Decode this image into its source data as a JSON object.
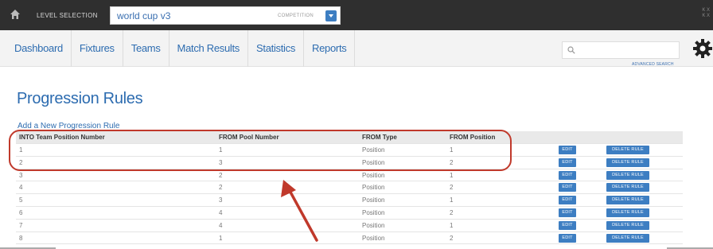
{
  "topbar": {
    "level_label": "LEVEL SELECTION",
    "competition_value": "world cup v3",
    "competition_tag": "COMPETITION",
    "right_text_1": "K X",
    "right_text_2": "K X"
  },
  "nav": {
    "items": [
      "Dashboard",
      "Fixtures",
      "Teams",
      "Match Results",
      "Statistics",
      "Reports"
    ]
  },
  "search": {
    "placeholder": "",
    "advanced_label": "ADVANCED SEARCH"
  },
  "page": {
    "title": "Progression Rules",
    "add_link": "Add a New Progression Rule"
  },
  "table": {
    "headers": [
      "INTO Team Position Number",
      "FROM Pool Number",
      "FROM Type",
      "FROM Position"
    ],
    "edit_label": "EDIT",
    "delete_label": "DELETE RULE",
    "rows": [
      [
        "1",
        "1",
        "Position",
        "1"
      ],
      [
        "2",
        "3",
        "Position",
        "2"
      ],
      [
        "3",
        "2",
        "Position",
        "1"
      ],
      [
        "4",
        "2",
        "Position",
        "2"
      ],
      [
        "5",
        "3",
        "Position",
        "1"
      ],
      [
        "6",
        "4",
        "Position",
        "2"
      ],
      [
        "7",
        "4",
        "Position",
        "1"
      ],
      [
        "8",
        "1",
        "Position",
        "2"
      ]
    ]
  },
  "colors": {
    "accent": "#2d6cb0",
    "button": "#3d7ec2",
    "highlight": "#c0392b",
    "topbar": "#2f2f2f"
  }
}
